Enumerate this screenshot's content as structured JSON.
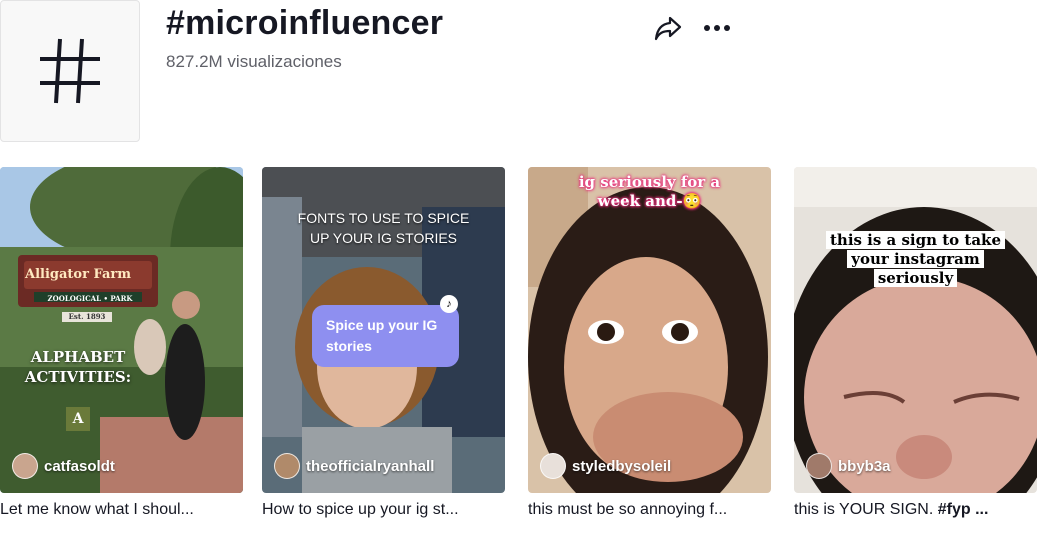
{
  "header": {
    "title": "#microinfluencer",
    "views": "827.2M visualizaciones",
    "icons": {
      "tag": "hashtag-icon",
      "share": "share-icon",
      "more": "more-icon"
    }
  },
  "videos": [
    {
      "author": "catfasoldt",
      "caption": "Let me know what I shoul...",
      "overlay": {
        "sign_text": "Alligator Farm",
        "sign_sub": "ZOOLOGICAL • PARK",
        "sign_year": "Est. 1893",
        "line1": "ALPHABET",
        "line2": "ACTIVITIES:",
        "letter": "A"
      }
    },
    {
      "author": "theofficialryanhall",
      "caption": "How to spice up your ig st...",
      "overlay": {
        "line1": "FONTS TO USE TO SPICE",
        "line2": "UP YOUR IG STORIES",
        "bubble": "Spice up your IG stories"
      }
    },
    {
      "author": "styledbysoleil",
      "caption": "this must be so annoying f...",
      "overlay": {
        "line1": "ig seriously for a",
        "line2": "week and-😳"
      }
    },
    {
      "author": "bbyb3a",
      "caption_text": "this is YOUR SIGN. ",
      "caption_bold": "#fyp ...",
      "overlay": {
        "line1": "this is a sign to take",
        "line2": "your instagram",
        "line3": "seriously"
      }
    }
  ],
  "colors": {
    "text": "#161823",
    "muted": "#5f6068",
    "bubble": "#8e8ff0"
  }
}
